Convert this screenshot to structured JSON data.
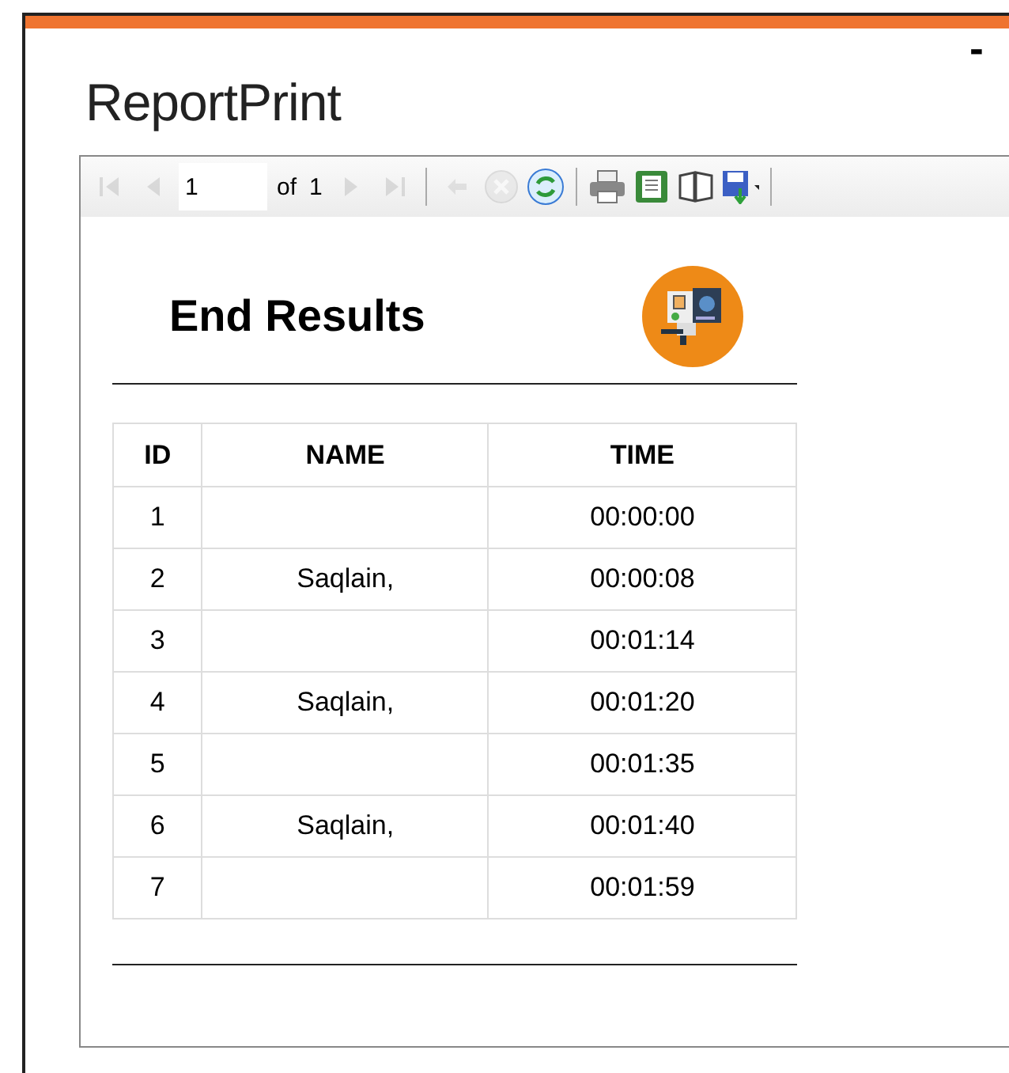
{
  "window": {
    "title": "ReportPrint",
    "minimize": "-"
  },
  "toolbar": {
    "page": "1",
    "of_label": "of",
    "page_count": "1",
    "buttons": [
      {
        "kind": "first",
        "disabled": true
      },
      {
        "kind": "prev",
        "disabled": true
      },
      {
        "kind": "page"
      },
      {
        "kind": "next",
        "disabled": true
      },
      {
        "kind": "last",
        "disabled": true
      },
      {
        "kind": "sep"
      },
      {
        "kind": "back",
        "disabled": true
      },
      {
        "kind": "stop",
        "disabled": true
      },
      {
        "kind": "refresh",
        "disabled": false
      },
      {
        "kind": "sep"
      },
      {
        "kind": "print",
        "disabled": false
      },
      {
        "kind": "layout",
        "disabled": false
      },
      {
        "kind": "pagesetup",
        "disabled": false
      },
      {
        "kind": "export",
        "disabled": false
      },
      {
        "kind": "sep"
      }
    ]
  },
  "report": {
    "title": "End Results",
    "columns": [
      "ID",
      "NAME",
      "TIME"
    ],
    "rows": [
      [
        "1",
        "",
        "00:00:00"
      ],
      [
        "2",
        "Saqlain,",
        "00:00:08"
      ],
      [
        "3",
        "",
        "00:01:14"
      ],
      [
        "4",
        "Saqlain,",
        "00:01:20"
      ],
      [
        "5",
        "",
        "00:01:35"
      ],
      [
        "6",
        "Saqlain,",
        "00:01:40"
      ],
      [
        "7",
        "",
        "00:01:59"
      ]
    ]
  }
}
